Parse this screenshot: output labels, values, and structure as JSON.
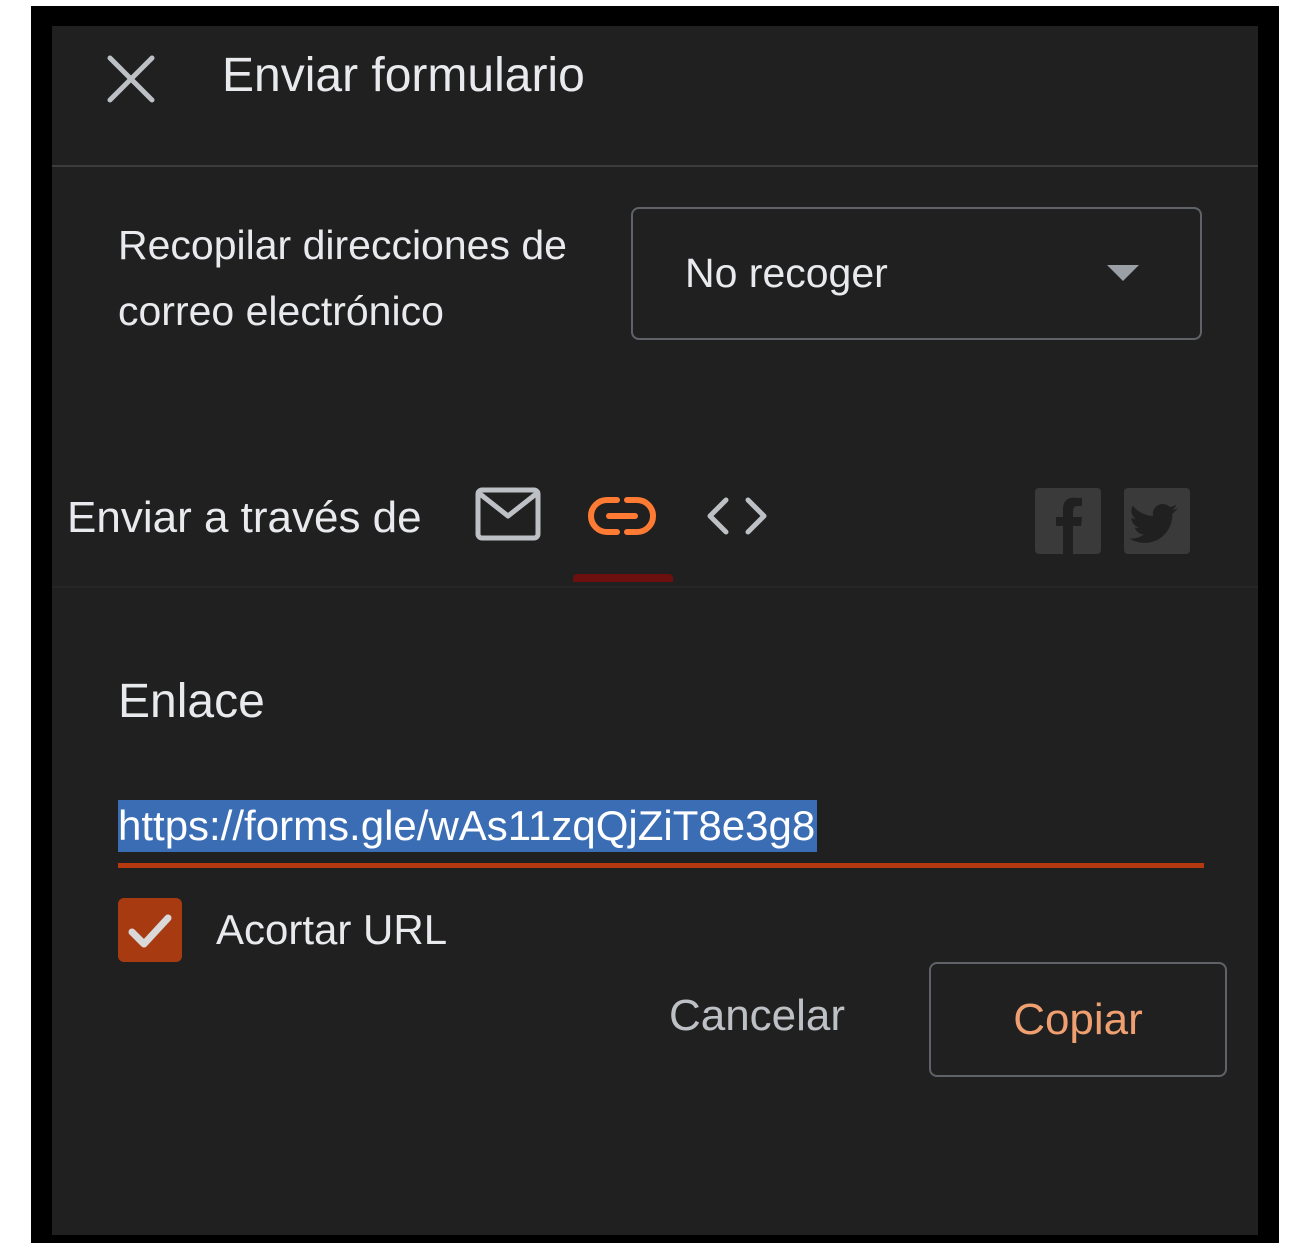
{
  "header": {
    "title": "Enviar formulario",
    "close_icon": "close-icon"
  },
  "collect_emails": {
    "label": "Recopilar direcciones de correo electrónico",
    "selected": "No recoger"
  },
  "send_via": {
    "label": "Enviar a través de",
    "tabs": [
      {
        "icon": "mail-icon",
        "active": false
      },
      {
        "icon": "link-icon",
        "active": true
      },
      {
        "icon": "embed-code-icon",
        "active": false
      }
    ],
    "social": [
      "facebook-icon",
      "twitter-icon"
    ]
  },
  "link_section": {
    "heading": "Enlace",
    "url": "https://forms.gle/wAs11zqQjZiT8e3g8",
    "shorten_label": "Acortar URL",
    "shorten_checked": true
  },
  "actions": {
    "cancel": "Cancelar",
    "copy": "Copiar"
  },
  "colors": {
    "dialog_bg": "#202020",
    "accent": "#f0a070",
    "active_icon": "#ff7a33",
    "underline": "#b5380f",
    "selection": "#3b6db5"
  }
}
